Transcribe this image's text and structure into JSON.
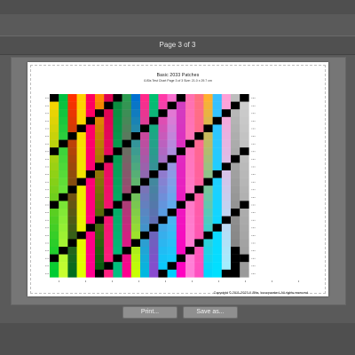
{
  "window": {
    "title": "Page 3 of 3"
  },
  "preview": {
    "chart_title": "Basic 2033 Patches",
    "subtitle": "i1iSis Test Chart Page 3 of 3  Size: 21.0 x 29.7 cm",
    "copyright": "Copyright © 2011-2023 X-Rite, Incorporated. All rights reserved."
  },
  "buttons": {
    "print_label": "Print...",
    "save_label": "Save as..."
  },
  "patch_columns": [
    {
      "top": "#ffd400",
      "bottom": "#00cc33",
      "accent": "#1a1a1a"
    },
    {
      "top": "#00c040",
      "bottom": "#c8ff30",
      "accent": "#007020"
    },
    {
      "top": "#ff3000",
      "bottom": "#006d1f",
      "accent": "#ff6a00"
    },
    {
      "top": "#ffd000",
      "bottom": "#e0ff00",
      "accent": "#ff7a00"
    },
    {
      "top": "#ff0060",
      "bottom": "#ff0090",
      "accent": "#ff7700"
    },
    {
      "top": "#ff8800",
      "bottom": "#005a10",
      "accent": "#a06000"
    },
    {
      "top": "#dd0050",
      "bottom": "#ff2080",
      "accent": "#111133"
    },
    {
      "top": "#0b8b3c",
      "bottom": "#00c080",
      "accent": "#2a3a30"
    },
    {
      "top": "#2b9c50",
      "bottom": "#ff0090",
      "accent": "#1c1c1c"
    },
    {
      "top": "#0070d0",
      "bottom": "#c8ff00",
      "accent": "#ff0070"
    },
    {
      "top": "#ff2a8a",
      "bottom": "#00b8e0",
      "accent": "#0000aa"
    },
    {
      "top": "#00c070",
      "bottom": "#8a4ad0",
      "accent": "#7000cc"
    },
    {
      "top": "#ff3aa8",
      "bottom": "#00d0ff",
      "accent": "#ff1070"
    },
    {
      "top": "#f870d0",
      "bottom": "#00d0ff",
      "accent": "#c000e0"
    },
    {
      "top": "#d040c0",
      "bottom": "#ff00c0",
      "accent": "#5000c0"
    },
    {
      "top": "#ff70b0",
      "bottom": "#ff80d8",
      "accent": "#0040e0"
    },
    {
      "top": "#ff7080",
      "bottom": "#ff50c0",
      "accent": "#ff90c0"
    },
    {
      "top": "#ffb030",
      "bottom": "#00d8ff",
      "accent": "#0000ff"
    },
    {
      "top": "#38c0ff",
      "bottom": "#00e0ff",
      "accent": "#ff40a0"
    },
    {
      "top": "#ffa0d8",
      "bottom": "#a0f0ff",
      "accent": "#00d0ff"
    },
    {
      "top": "#bdbdbd",
      "bottom": "#7a7a7a",
      "accent": "#000000"
    },
    {
      "top": "#cfcfcf",
      "bottom": "#9a9a9a",
      "accent": "#7a7a7a"
    }
  ]
}
